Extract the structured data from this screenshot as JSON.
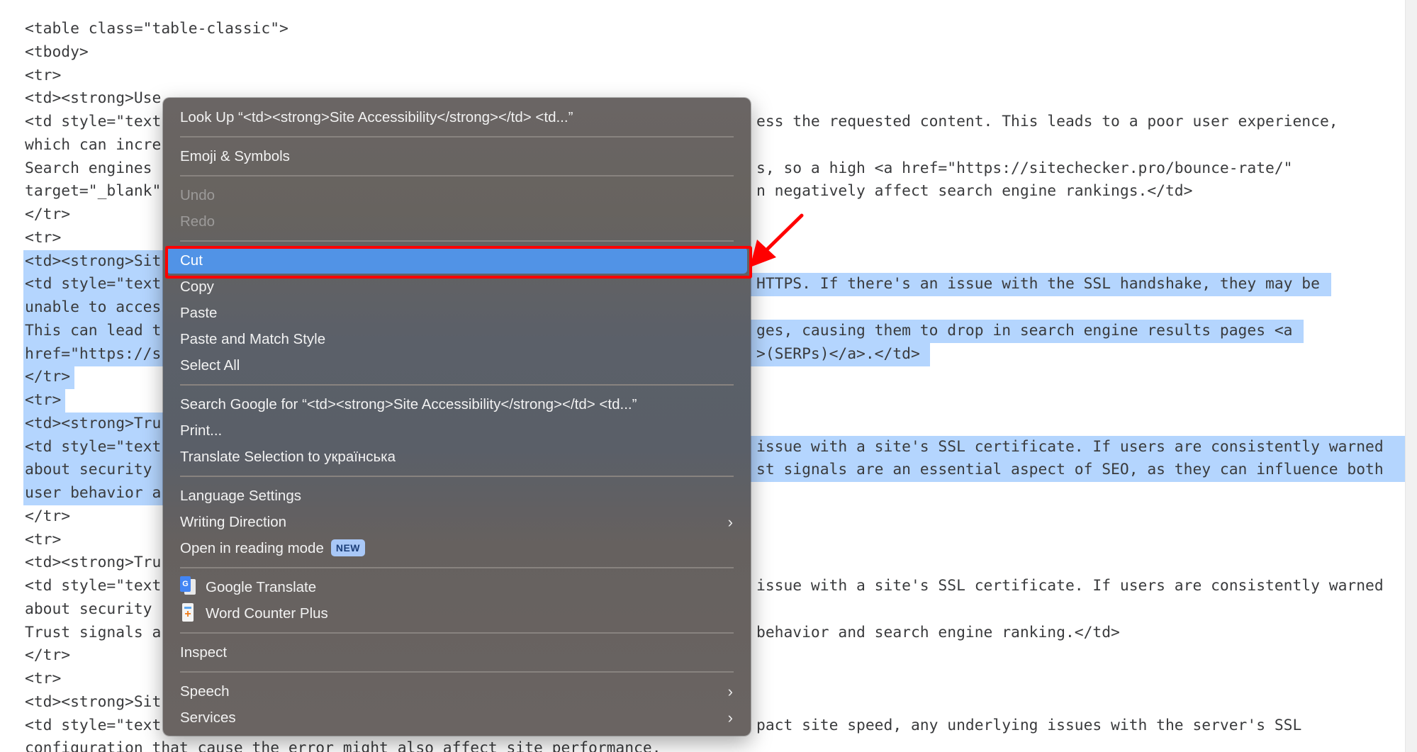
{
  "editor": {
    "lines": [
      {
        "text": "<table class=\"table-classic\">",
        "selected": false
      },
      {
        "text": "<tbody>",
        "selected": false
      },
      {
        "text": "<tr>",
        "selected": false
      },
      {
        "text": "<td><strong>User Experience (UX)</strong></td>",
        "selected": false,
        "left_text": "<td><strong>Use",
        "right_text": ""
      },
      {
        "text": "",
        "left_text": "<td style=\"text",
        "right_text": "ess the requested content. This leads to a poor user experience,",
        "selected": false
      },
      {
        "text": "",
        "left_text": "which can incre",
        "right_text": "",
        "selected": false
      },
      {
        "text": "",
        "left_text": "Search engines ",
        "right_text": "s, so a high <a href=\"https://sitechecker.pro/bounce-rate/\"",
        "selected": false
      },
      {
        "text": "",
        "left_text": "target=\"_blank\"",
        "right_text": "n negatively affect search engine rankings.</td>",
        "selected": false
      },
      {
        "text": "</tr>",
        "selected": false
      },
      {
        "text": "<tr>",
        "selected": false
      },
      {
        "text": "",
        "left_text": "<td><strong>Sit",
        "right_text": "",
        "selected": true
      },
      {
        "text": "",
        "left_text": "<td style=\"text",
        "right_text": "HTTPS. If there's an issue with the SSL handshake, they may be",
        "selected": true
      },
      {
        "text": "",
        "left_text": "unable to acces",
        "right_text": "",
        "selected": true
      },
      {
        "text": "",
        "left_text": "This can lead t",
        "right_text": "ges, causing them to drop in search engine results pages <a",
        "selected": true
      },
      {
        "text": "",
        "left_text": "href=\"https://s",
        "right_text": ">(SERPs)</a>.</td>",
        "selected": true
      },
      {
        "text": "</tr>",
        "selected": true
      },
      {
        "text": "<tr>",
        "selected": true
      },
      {
        "text": "",
        "left_text": "<td><strong>Tru",
        "right_text": "",
        "selected": true
      },
      {
        "text": "",
        "left_text": "<td style=\"text",
        "right_text": "issue with a site's SSL certificate. If users are consistently warned",
        "selected": true
      },
      {
        "text": "",
        "left_text": "about security ",
        "right_text": "st signals are an essential aspect of SEO, as they can influence both",
        "selected": true
      },
      {
        "text": "",
        "left_text": "user behavior a",
        "right_text": "",
        "selected": true
      },
      {
        "text": "</tr>",
        "selected": false
      },
      {
        "text": "<tr>",
        "selected": false
      },
      {
        "text": "",
        "left_text": "<td><strong>Tru",
        "right_text": "",
        "selected": false
      },
      {
        "text": "",
        "left_text": "<td style=\"text",
        "right_text": "issue with a site's SSL certificate. If users are consistently warned",
        "selected": false
      },
      {
        "text": "",
        "left_text": "about security ",
        "right_text": "",
        "selected": false
      },
      {
        "text": "",
        "left_text": "Trust signals a",
        "right_text": "behavior and search engine ranking.</td>",
        "selected": false
      },
      {
        "text": "</tr>",
        "selected": false
      },
      {
        "text": "<tr>",
        "selected": false
      },
      {
        "text": "",
        "left_text": "<td><strong>Sit",
        "right_text": "",
        "selected": false
      },
      {
        "text": "",
        "left_text": "<td style=\"text",
        "right_text": "pact site speed, any underlying issues with the server's SSL",
        "selected": false
      },
      {
        "text": "configuration that cause the error might also affect site performance.",
        "selected": false
      }
    ]
  },
  "context_menu": {
    "items": [
      {
        "id": "look-up",
        "label": "Look Up “<td><strong>Site Accessibility</strong></td> <td...”",
        "disabled": false
      },
      {
        "sep": true
      },
      {
        "id": "emoji-symbols",
        "label": "Emoji & Symbols",
        "disabled": false
      },
      {
        "sep": true
      },
      {
        "id": "undo",
        "label": "Undo",
        "disabled": true
      },
      {
        "id": "redo",
        "label": "Redo",
        "disabled": true
      },
      {
        "sep": true
      },
      {
        "id": "cut",
        "label": "Cut",
        "disabled": false,
        "highlighted": true
      },
      {
        "id": "copy",
        "label": "Copy",
        "disabled": false
      },
      {
        "id": "paste",
        "label": "Paste",
        "disabled": false
      },
      {
        "id": "paste-match-style",
        "label": "Paste and Match Style",
        "disabled": false
      },
      {
        "id": "select-all",
        "label": "Select All",
        "disabled": false
      },
      {
        "sep": true
      },
      {
        "id": "search-google",
        "label": "Search Google for “<td><strong>Site Accessibility</strong></td> <td...”",
        "disabled": false
      },
      {
        "id": "print",
        "label": "Print...",
        "disabled": false
      },
      {
        "id": "translate-selection",
        "label": "Translate Selection to українська",
        "disabled": false
      },
      {
        "sep": true
      },
      {
        "id": "language-settings",
        "label": "Language Settings",
        "disabled": false
      },
      {
        "id": "writing-direction",
        "label": "Writing Direction",
        "disabled": false,
        "submenu": true
      },
      {
        "id": "reading-mode",
        "label": "Open in reading mode",
        "disabled": false,
        "badge": "NEW"
      },
      {
        "sep": true
      },
      {
        "id": "google-translate",
        "label": "Google Translate",
        "disabled": false,
        "icon": "google-translate-icon"
      },
      {
        "id": "word-counter-plus",
        "label": "Word Counter Plus",
        "disabled": false,
        "icon": "word-counter-icon"
      },
      {
        "sep": true
      },
      {
        "id": "inspect",
        "label": "Inspect",
        "disabled": false
      },
      {
        "sep": true
      },
      {
        "id": "speech",
        "label": "Speech",
        "disabled": false,
        "submenu": true
      },
      {
        "id": "services",
        "label": "Services",
        "disabled": false,
        "submenu": true
      }
    ],
    "submenu_glyph": "›",
    "google_translate_glyph": "G",
    "word_counter_glyph": "+"
  },
  "annotation": {
    "highlight_color": "#ff0000",
    "target": "Cut"
  },
  "colors": {
    "selection": "#b4d5fe",
    "menu_highlight": "#5193e6",
    "code_text": "#3a3b3d"
  }
}
